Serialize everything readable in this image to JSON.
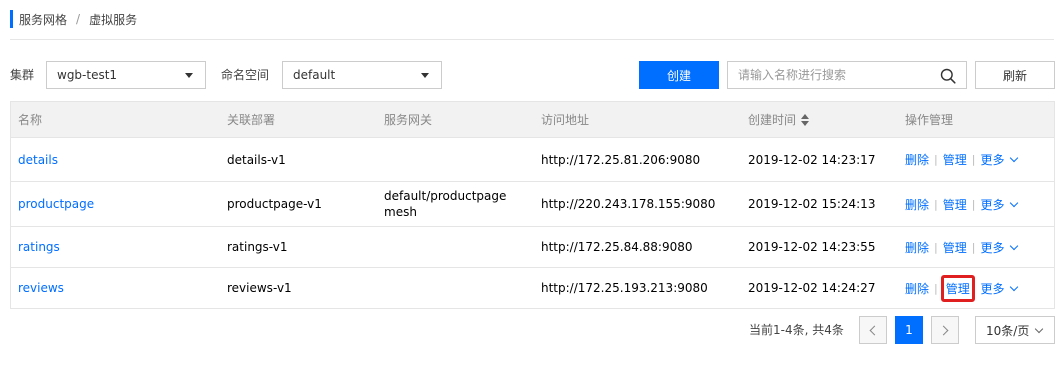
{
  "breadcrumb": {
    "parent": "服务网格",
    "separator": "/",
    "current": "虚拟服务"
  },
  "filters": {
    "cluster_label": "集群",
    "cluster_value": "wgb-test1",
    "namespace_label": "命名空间",
    "namespace_value": "default"
  },
  "toolbar": {
    "create_label": "创建",
    "search_placeholder": "请输入名称进行搜索",
    "refresh_label": "刷新"
  },
  "table": {
    "headers": {
      "name": "名称",
      "deployment": "关联部署",
      "gateway": "服务网关",
      "address": "访问地址",
      "created": "创建时间",
      "ops": "操作管理"
    },
    "rows": [
      {
        "name": "details",
        "deployment": "details-v1",
        "gateway_line1": "",
        "gateway_line2": "",
        "address": "http://172.25.81.206:9080",
        "created": "2019-12-02 14:23:17"
      },
      {
        "name": "productpage",
        "deployment": "productpage-v1",
        "gateway_line1": "default/productpage",
        "gateway_line2": "mesh",
        "address": "http://220.243.178.155:9080",
        "created": "2019-12-02 15:24:13"
      },
      {
        "name": "ratings",
        "deployment": "ratings-v1",
        "gateway_line1": "",
        "gateway_line2": "",
        "address": "http://172.25.84.88:9080",
        "created": "2019-12-02 14:23:55"
      },
      {
        "name": "reviews",
        "deployment": "reviews-v1",
        "gateway_line1": "",
        "gateway_line2": "",
        "address": "http://172.25.193.213:9080",
        "created": "2019-12-02 14:24:27"
      }
    ],
    "ops": {
      "delete": "删除",
      "manage": "管理",
      "more": "更多",
      "separator": "|"
    }
  },
  "pagination": {
    "info": "当前1-4条,  共4条",
    "current_page": "1",
    "page_size": "10条/页"
  },
  "colors": {
    "accent": "#006eff",
    "highlight": "#e02020"
  }
}
